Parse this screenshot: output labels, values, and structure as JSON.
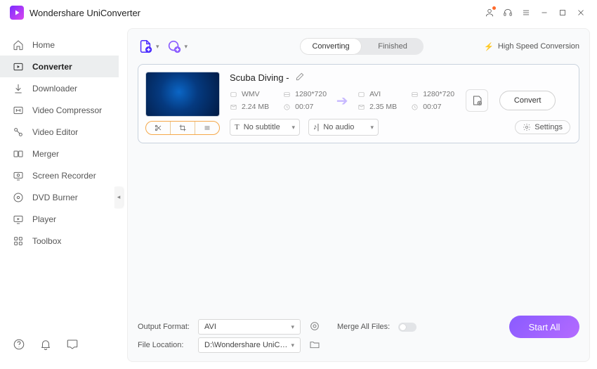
{
  "app": {
    "title": "Wondershare UniConverter"
  },
  "sidebar": {
    "items": [
      {
        "label": "Home"
      },
      {
        "label": "Converter"
      },
      {
        "label": "Downloader"
      },
      {
        "label": "Video Compressor"
      },
      {
        "label": "Video Editor"
      },
      {
        "label": "Merger"
      },
      {
        "label": "Screen Recorder"
      },
      {
        "label": "DVD Burner"
      },
      {
        "label": "Player"
      },
      {
        "label": "Toolbox"
      }
    ]
  },
  "tabs": {
    "converting": "Converting",
    "finished": "Finished"
  },
  "highspeed": "High Speed Conversion",
  "file": {
    "name": "Scuba Diving -",
    "src": {
      "format": "WMV",
      "resolution": "1280*720",
      "size": "2.24 MB",
      "duration": "00:07"
    },
    "dst": {
      "format": "AVI",
      "resolution": "1280*720",
      "size": "2.35 MB",
      "duration": "00:07"
    },
    "subtitle": "No subtitle",
    "audio": "No audio",
    "settings": "Settings",
    "convert": "Convert"
  },
  "footer": {
    "output_format_label": "Output Format:",
    "output_format": "AVI",
    "file_location_label": "File Location:",
    "file_location": "D:\\Wondershare UniConverter",
    "merge_label": "Merge All Files:",
    "start_all": "Start All"
  }
}
